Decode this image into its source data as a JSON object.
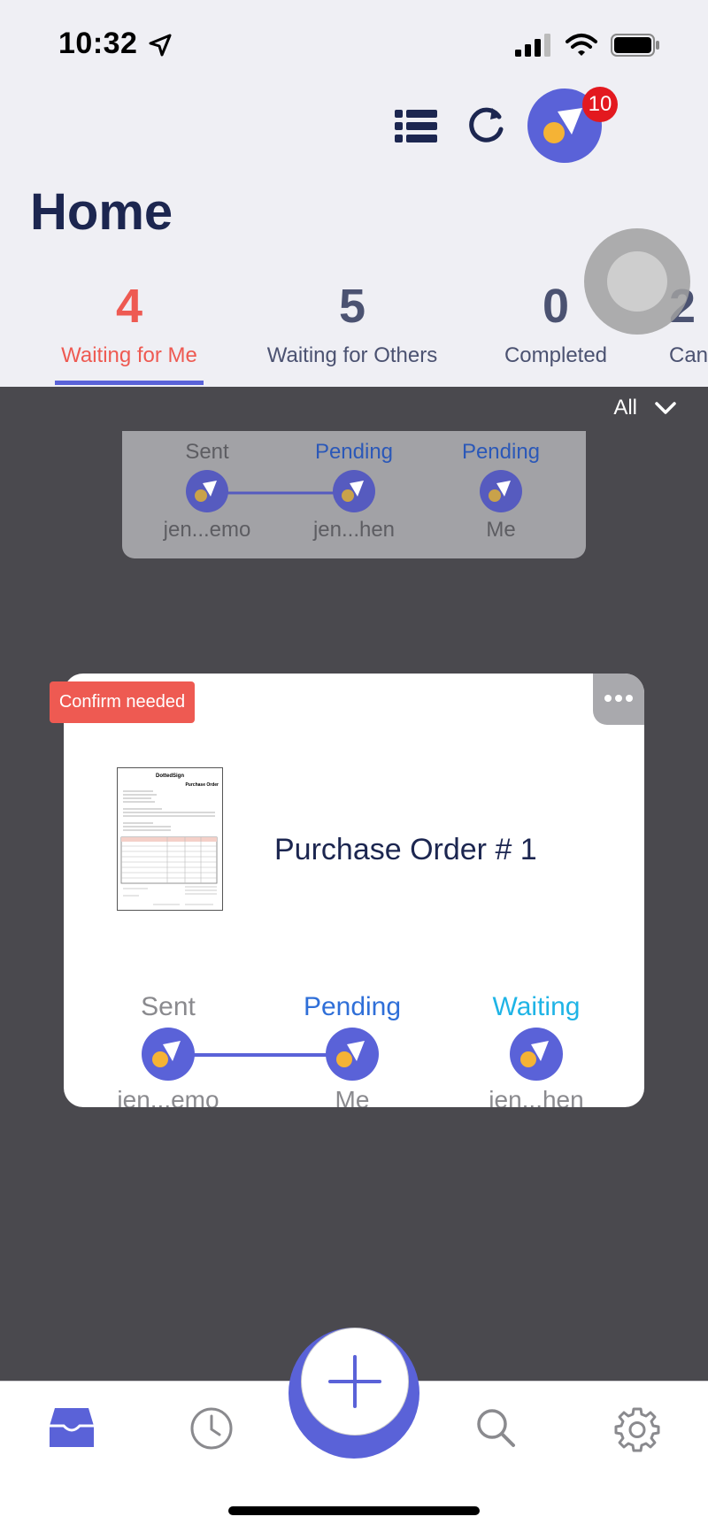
{
  "status_bar": {
    "time": "10:32"
  },
  "header": {
    "notification_count": "10",
    "title": "Home",
    "colors": {
      "accent": "#5a62d8",
      "active": "#ee5a52"
    }
  },
  "tabs": [
    {
      "count": "4",
      "label": "Waiting for Me"
    },
    {
      "count": "5",
      "label": "Waiting for Others"
    },
    {
      "count": "0",
      "label": "Completed"
    },
    {
      "count": "2",
      "label": "Can"
    }
  ],
  "filter": {
    "label": "All"
  },
  "prev_card": {
    "steps": [
      {
        "status": "Sent",
        "name": "jen...emo"
      },
      {
        "status": "Pending",
        "name": "jen...hen"
      },
      {
        "status": "Pending",
        "name": "Me"
      }
    ]
  },
  "main_card": {
    "badge": "Confirm needed",
    "title": "Purchase Order # 1",
    "thumbnail": {
      "brand": "DottedSign",
      "heading": "Purchase Order"
    },
    "steps": [
      {
        "status": "Sent",
        "name": "jen...emo"
      },
      {
        "status": "Pending",
        "name": "Me"
      },
      {
        "status": "Waiting",
        "name": "jen...hen"
      }
    ]
  },
  "bottom_nav": {
    "items": [
      "inbox-icon",
      "clock-icon",
      "plus-icon",
      "search-icon",
      "gear-icon"
    ]
  }
}
